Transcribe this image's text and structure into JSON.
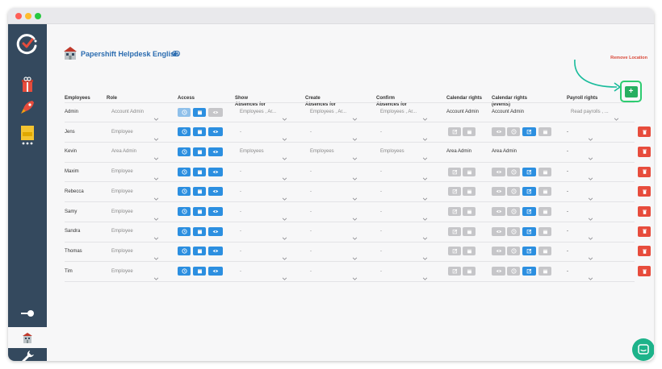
{
  "location": {
    "title": "Papershift Helpdesk English",
    "remove_label": "Remove Location"
  },
  "headers": {
    "employees": "Employees",
    "role": "Role",
    "access": "Access",
    "show_line1": "Show",
    "show_line2": "Absences for",
    "create_line1": "Create",
    "create_line2": "Absences for",
    "confirm_line1": "Confirm",
    "confirm_line2": "Absences for",
    "calendar_rights": "Calendar rights",
    "calendar_events_line1": "Calendar rights",
    "calendar_events_line2": "(events)",
    "payroll_rights": "Payroll rights"
  },
  "add_button_label": "+",
  "colors": {
    "sidebar": "#34495e",
    "primary_blue": "#2c8fe0",
    "danger": "#e74c3c",
    "success": "#27ae60",
    "chat": "#1db38a"
  },
  "rows": [
    {
      "name": "Admin",
      "role": "Account Admin",
      "show": "Employees , Ar...",
      "create": "Employees , Ar...",
      "confirm": "Employees , Ar...",
      "calendar": "Account Admin",
      "events": "Account Admin",
      "payroll": "Read payrolls , ..."
    },
    {
      "name": "Jens",
      "role": "Employee",
      "show": "-",
      "create": "-",
      "confirm": "-",
      "calendar": "",
      "events": "",
      "payroll": "-"
    },
    {
      "name": "Kevin",
      "role": "Area Admin",
      "show": "Employees",
      "create": "Employees",
      "confirm": "Employees",
      "calendar": "Area Admin",
      "events": "Area Admin",
      "payroll": "-"
    },
    {
      "name": "Maxim",
      "role": "Employee",
      "show": "-",
      "create": "-",
      "confirm": "-",
      "calendar": "",
      "events": "",
      "payroll": "-"
    },
    {
      "name": "Rebecca",
      "role": "Employee",
      "show": "-",
      "create": "-",
      "confirm": "-",
      "calendar": "",
      "events": "",
      "payroll": "-"
    },
    {
      "name": "Samy",
      "role": "Employee",
      "show": "-",
      "create": "-",
      "confirm": "-",
      "calendar": "",
      "events": "",
      "payroll": "-"
    },
    {
      "name": "Sandra",
      "role": "Employee",
      "show": "-",
      "create": "-",
      "confirm": "-",
      "calendar": "",
      "events": "",
      "payroll": "-"
    },
    {
      "name": "Thomas",
      "role": "Employee",
      "show": "-",
      "create": "-",
      "confirm": "-",
      "calendar": "",
      "events": "",
      "payroll": "-"
    },
    {
      "name": "Tim",
      "role": "Employee",
      "show": "-",
      "create": "-",
      "confirm": "-",
      "calendar": "",
      "events": "",
      "payroll": "-"
    }
  ]
}
